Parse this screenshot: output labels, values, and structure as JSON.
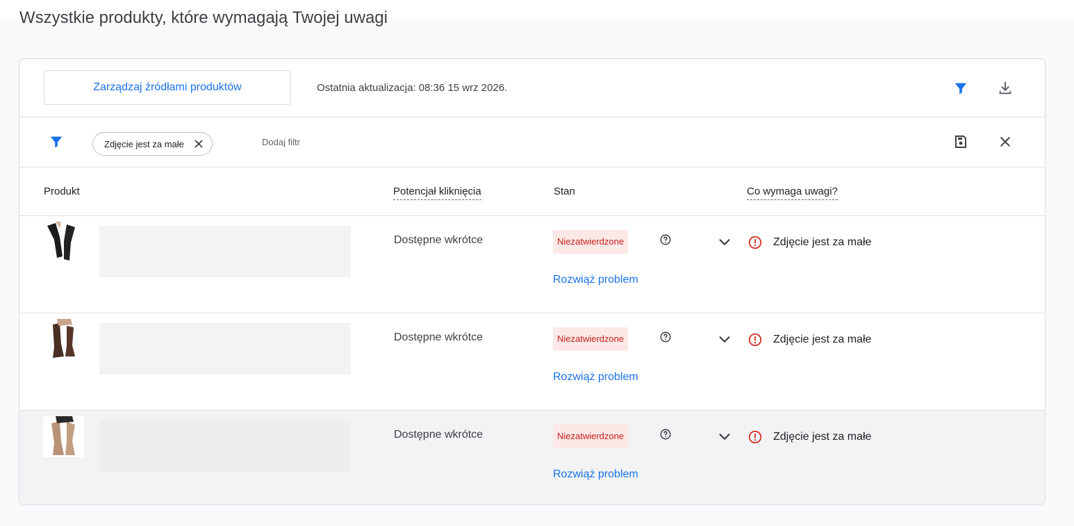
{
  "page": {
    "heading": "Wszystkie produkty, które wymagają Twojej uwagi"
  },
  "toolbar": {
    "manage_label": "Zarządzaj źródłami produktów",
    "last_update": "Ostatnia aktualizacja: 08:36 15 wrz 2026."
  },
  "filters": {
    "active": [
      {
        "label": "Zdjęcie jest za małe"
      }
    ],
    "add_label": "Dodaj filtr"
  },
  "table": {
    "headers": {
      "product": "Produkt",
      "clicks": "Potencjał kliknięcia",
      "status": "Stan",
      "issue": "Co wymaga uwagi?"
    },
    "rows": [
      {
        "clicks": "Dostępne wkrótce",
        "status": "Niezatwierdzone",
        "action": "Rozwiąż problem",
        "issue": "Zdjęcie jest za małe"
      },
      {
        "clicks": "Dostępne wkrótce",
        "status": "Niezatwierdzone",
        "action": "Rozwiąż problem",
        "issue": "Zdjęcie jest za małe"
      },
      {
        "clicks": "Dostępne wkrótce",
        "status": "Niezatwierdzone",
        "action": "Rozwiąż problem",
        "issue": "Zdjęcie jest za małe"
      }
    ]
  },
  "colors": {
    "accent": "#1a73e8",
    "error": "#d93025",
    "badge_bg": "#fce8e6",
    "badge_text": "#c5221f",
    "highlight_row": "#f1f3f4"
  },
  "icons": {
    "toolbar": [
      "filter-icon",
      "download-icon"
    ],
    "filterbar": [
      "filter-icon",
      "close-icon",
      "save-icon",
      "close-icon"
    ],
    "row": [
      "help-icon",
      "chevron-down-icon",
      "error-icon"
    ]
  }
}
